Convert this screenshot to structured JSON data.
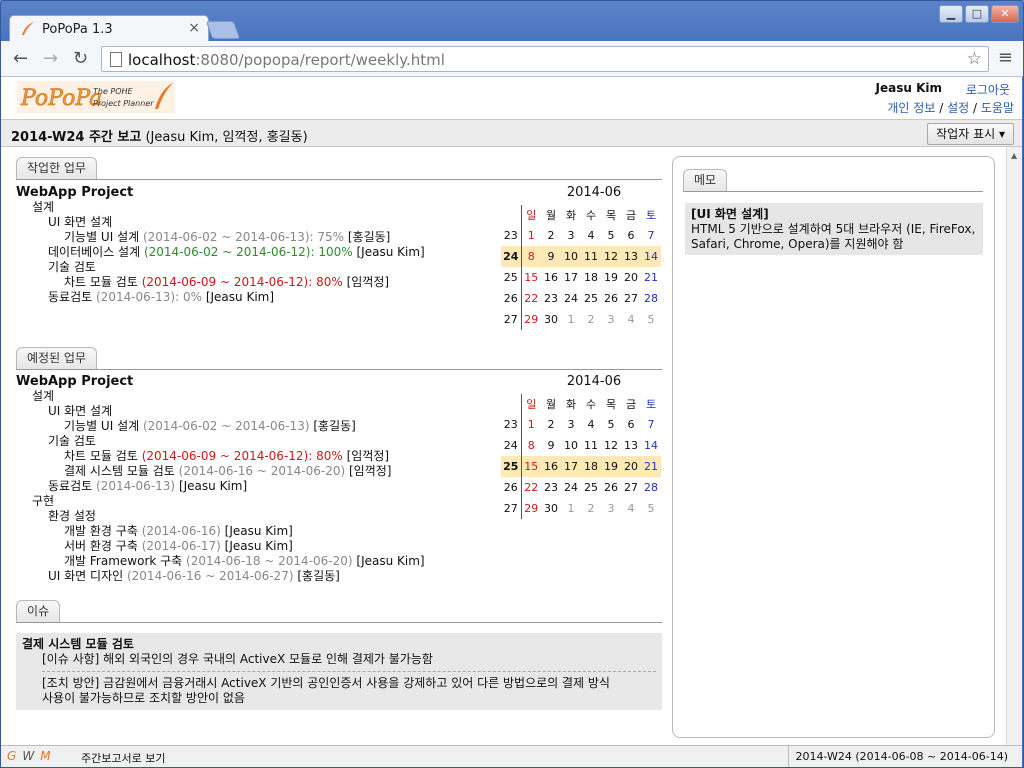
{
  "browser": {
    "tab_title": "PoPoPa 1.3",
    "tab_close": "×",
    "url_host": "localhost",
    "url_rest": ":8080/popopa/report/weekly.html"
  },
  "header": {
    "logo_text": "PoPoPa",
    "logo_sub1": "The POHE",
    "logo_sub2": "Project Planner",
    "user_name": "Jeasu Kim",
    "logout": "로그아웃",
    "link_profile": "개인 정보",
    "link_settings": "설정",
    "link_help": "도움말",
    "separator": "/"
  },
  "report": {
    "title": "2014-W24 주간 보고",
    "members": "(Jeasu Kim, 임꺽정, 홍길동)",
    "writer_button": "작업자 표시 ▾"
  },
  "done": {
    "tab": "작업한 업무",
    "project": "WebApp Project",
    "l_design": "설계",
    "l_ui": "UI 화면 설계",
    "t1_name": "기능별 UI 설계",
    "t1_date": "(2014-06-02 ~ 2014-06-13): 75%",
    "t1_who": "[홍길동]",
    "t2_name": "데이터베이스 설계",
    "t2_date": "(2014-06-02 ~ 2014-06-12): 100%",
    "t2_who": "[Jeasu Kim]",
    "l_tech": "기술 검토",
    "t3_name": "차트 모듈 검토",
    "t3_date": "(2014-06-09 ~ 2014-06-12): 80%",
    "t3_who": "[임꺽정]",
    "t4_name": "동료검토",
    "t4_date": "(2014-06-13): 0%",
    "t4_who": "[Jeasu Kim]"
  },
  "planned": {
    "tab": "예정된 업무",
    "project": "WebApp Project",
    "l_design": "설계",
    "l_ui": "UI 화면 설계",
    "p1_name": "기능별 UI 설계",
    "p1_date": "(2014-06-02 ~ 2014-06-13)",
    "p1_who": "[홍길동]",
    "l_tech": "기술 검토",
    "p2_name": "차트 모듈 검토",
    "p2_date": "(2014-06-09 ~ 2014-06-12): 80%",
    "p2_who": "[임꺽정]",
    "p3_name": "결제 시스템 모듈 검토",
    "p3_date": "(2014-06-16 ~ 2014-06-20)",
    "p3_who": "[임꺽정]",
    "p4_name": "동료검토",
    "p4_date": "(2014-06-13)",
    "p4_who": "[Jeasu Kim]",
    "l_impl": "구현",
    "l_env": "환경 설정",
    "p5_name": "개발 환경 구축",
    "p5_date": "(2014-06-16)",
    "p5_who": "[Jeasu Kim]",
    "p6_name": "서버 환경 구축",
    "p6_date": "(2014-06-17)",
    "p6_who": "[Jeasu Kim]",
    "p7_name": "개발 Framework 구축",
    "p7_date": "(2014-06-18 ~ 2014-06-20)",
    "p7_who": "[Jeasu Kim]",
    "p8_name": "UI 화면 디자인",
    "p8_date": "(2014-06-16 ~ 2014-06-27)",
    "p8_who": "[홍길동]"
  },
  "calendar": {
    "title": "2014-06",
    "days": [
      "일",
      "월",
      "화",
      "수",
      "목",
      "금",
      "토"
    ],
    "weeks": [
      {
        "wk": "23",
        "d": [
          "1",
          "2",
          "3",
          "4",
          "5",
          "6",
          "7"
        ]
      },
      {
        "wk": "24",
        "d": [
          "8",
          "9",
          "10",
          "11",
          "12",
          "13",
          "14"
        ]
      },
      {
        "wk": "25",
        "d": [
          "15",
          "16",
          "17",
          "18",
          "19",
          "20",
          "21"
        ]
      },
      {
        "wk": "26",
        "d": [
          "22",
          "23",
          "24",
          "25",
          "26",
          "27",
          "28"
        ]
      },
      {
        "wk": "27",
        "d": [
          "29",
          "30",
          "1",
          "2",
          "3",
          "4",
          "5"
        ]
      }
    ],
    "done_current_week": "24",
    "planned_current_week": "25"
  },
  "issue": {
    "tab": "이슈",
    "title": "결제 시스템 모듈 검토",
    "line1": "[이슈 사항] 해외 외국인의 경우 국내의 ActiveX 모듈로 인해 결제가 불가능함",
    "line2": "[조치 방안] 금감원에서 금융거래시 ActiveX 기반의 공인인증서 사용을 강제하고 있어 다른 방법으로의 결제 방식",
    "line3": "사용이 불가능하므로 조치할 방안이 없음"
  },
  "memo": {
    "tab": "메모",
    "title": "[UI 화면 설계]",
    "body": "HTML 5 기반으로 설계하여 5대 브라우저 (IE, FireFox, Safari, Chrome, Opera)를 지원해야 함"
  },
  "status": {
    "g": "G",
    "w": "W",
    "m": "M",
    "label": "주간보고서로 보기",
    "range": "2014-W24 (2014-06-08 ~ 2014-06-14)"
  }
}
